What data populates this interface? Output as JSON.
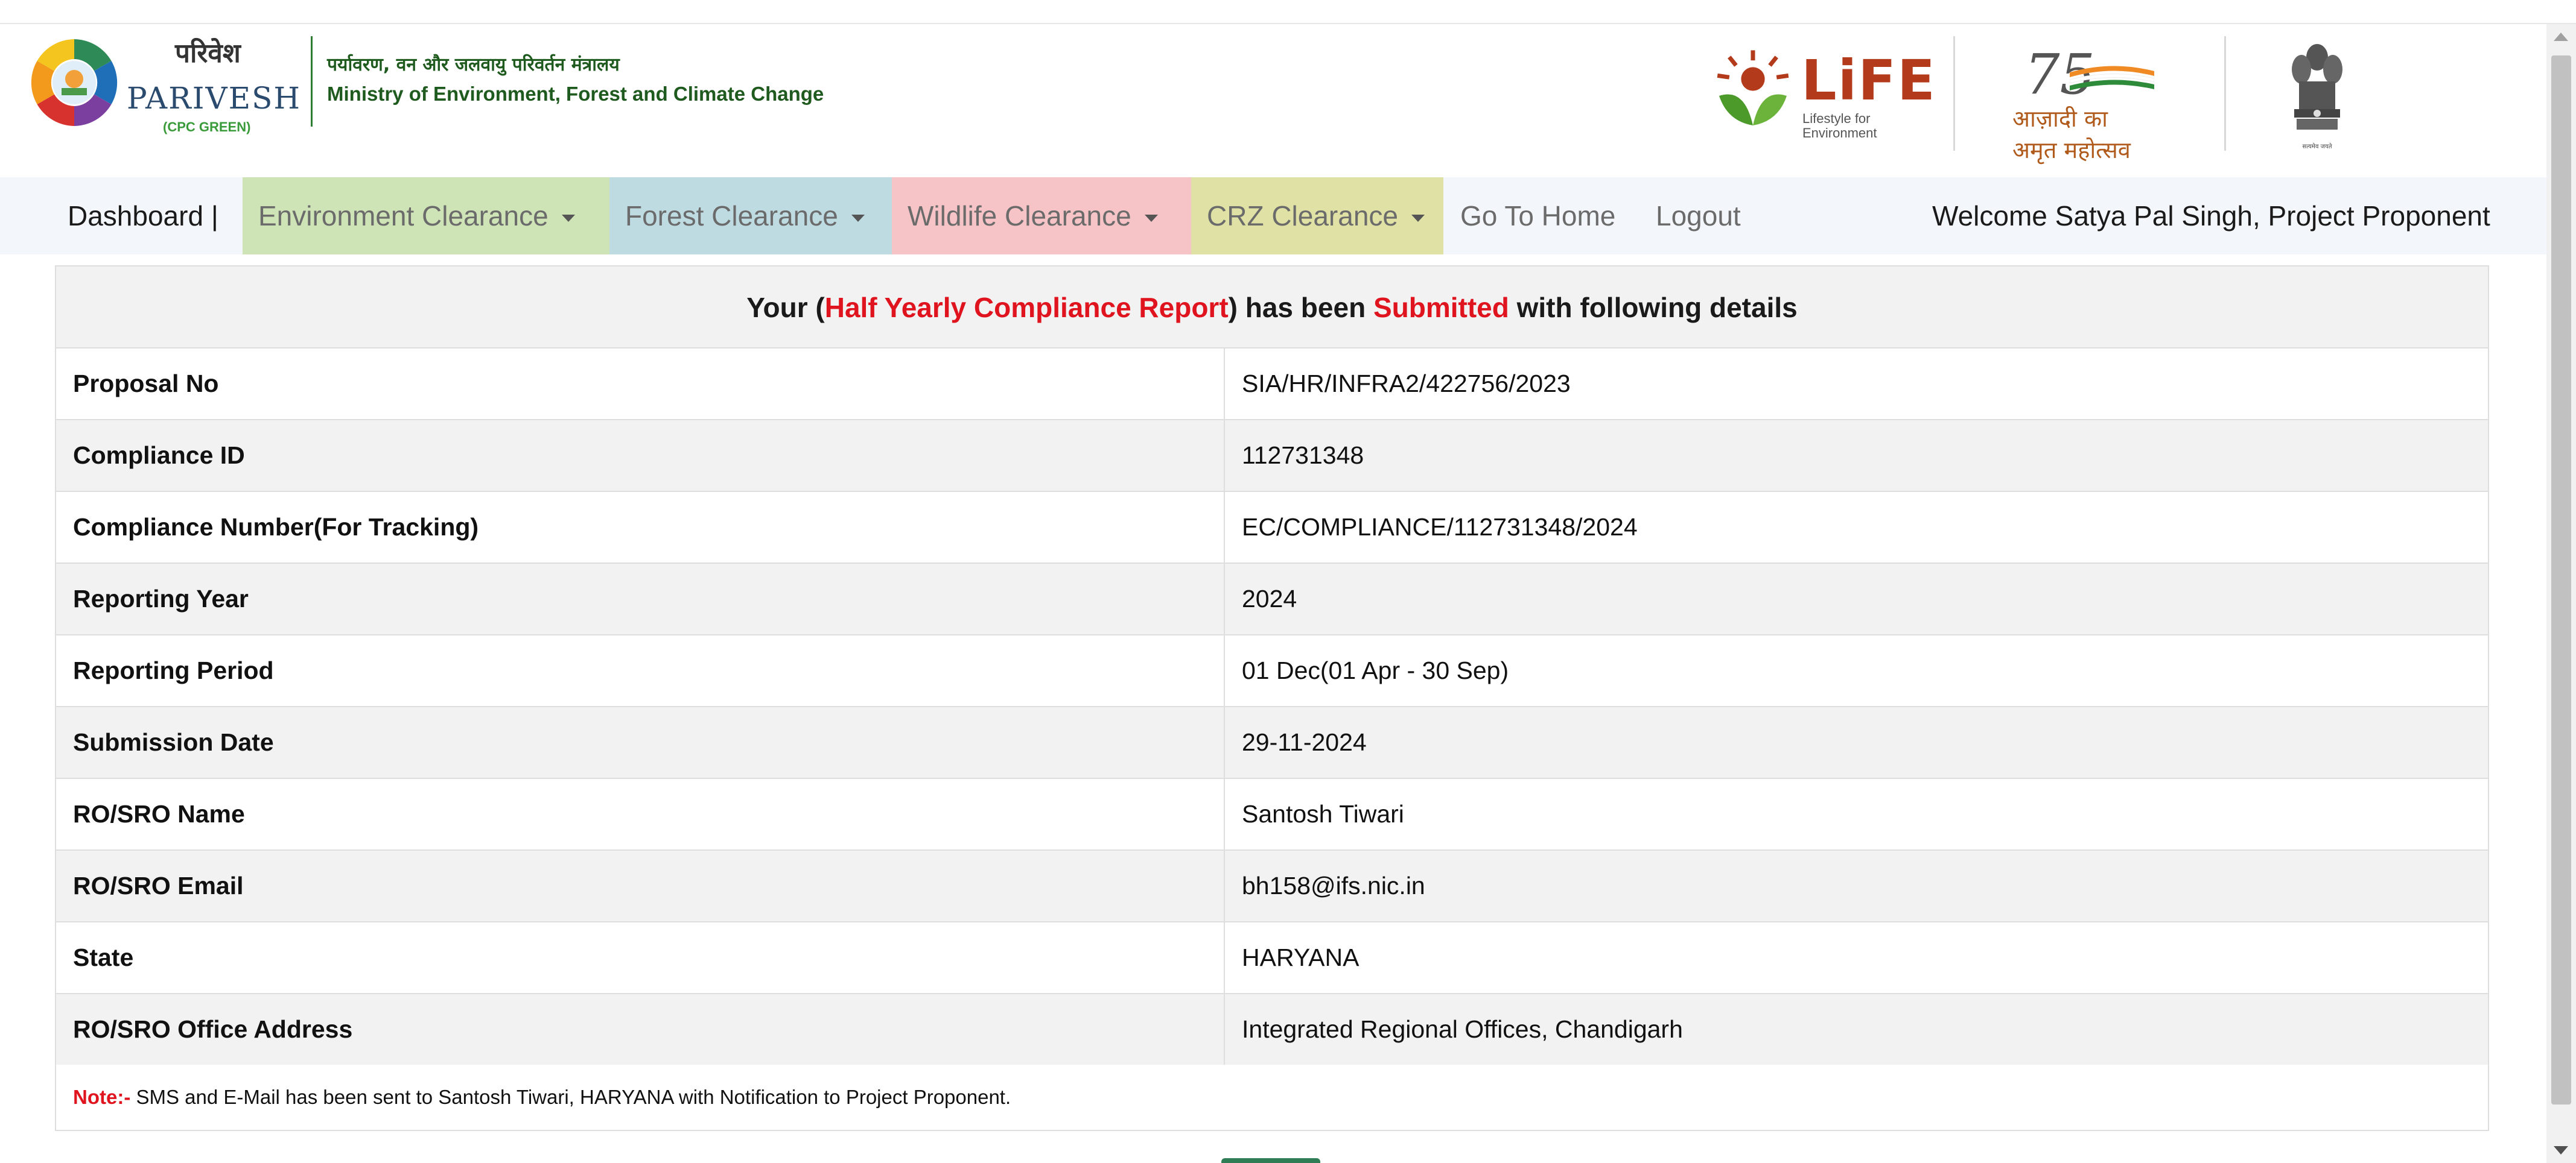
{
  "header": {
    "logo_hindi": "परिवेश",
    "logo_name": "PARIVESH",
    "logo_tag": "(CPC GREEN)",
    "ministry_hindi": "पर्यावरण, वन और जलवायु परिवर्तन मंत्रालय",
    "ministry_en": "Ministry of Environment, Forest and Climate Change",
    "life_word": "LiFE",
    "life_sub_1": "Lifestyle for",
    "life_sub_2": "Environment",
    "azadi_number": "75",
    "azadi_text": "आज़ादी का अमृत महोत्सव",
    "emblem_caption": "सत्यमेव जयते"
  },
  "nav": {
    "dashboard": "Dashboard |",
    "environment": "Environment Clearance",
    "forest": "Forest Clearance",
    "wildlife": "Wildlife Clearance",
    "crz": "CRZ Clearance",
    "home": "Go To Home",
    "logout": "Logout",
    "welcome": "Welcome Satya Pal Singh, Project Proponent"
  },
  "report": {
    "title_prefix": "Your (",
    "title_report": "Half Yearly Compliance Report",
    "title_middle": ") has been ",
    "title_status": "Submitted",
    "title_suffix": " with following details",
    "rows": [
      {
        "label": "Proposal No",
        "value": "SIA/HR/INFRA2/422756/2023"
      },
      {
        "label": "Compliance ID",
        "value": "112731348"
      },
      {
        "label": "Compliance Number(For Tracking)",
        "value": "EC/COMPLIANCE/112731348/2024"
      },
      {
        "label": "Reporting Year",
        "value": "2024"
      },
      {
        "label": "Reporting Period",
        "value": "01 Dec(01 Apr - 30 Sep)"
      },
      {
        "label": "Submission Date",
        "value": "29-11-2024"
      },
      {
        "label": "RO/SRO Name",
        "value": "Santosh Tiwari"
      },
      {
        "label": "RO/SRO Email",
        "value": "bh158@ifs.nic.in"
      },
      {
        "label": "State",
        "value": "HARYANA"
      },
      {
        "label": "RO/SRO Office Address",
        "value": "Integrated Regional Offices, Chandigarh"
      }
    ],
    "note_label": "Note:-",
    "note_text": " SMS and E-Mail has been sent to Santosh Tiwari, HARYANA with Notification to Project Proponent."
  },
  "colors": {
    "env_tab": "#cfe4b6",
    "forest_tab": "#bfdbe2",
    "wildlife_tab": "#f6c4c6",
    "crz_tab": "#dfe1a5",
    "highlight_red": "#e0141e",
    "ministry_green": "#1f5a1f"
  }
}
